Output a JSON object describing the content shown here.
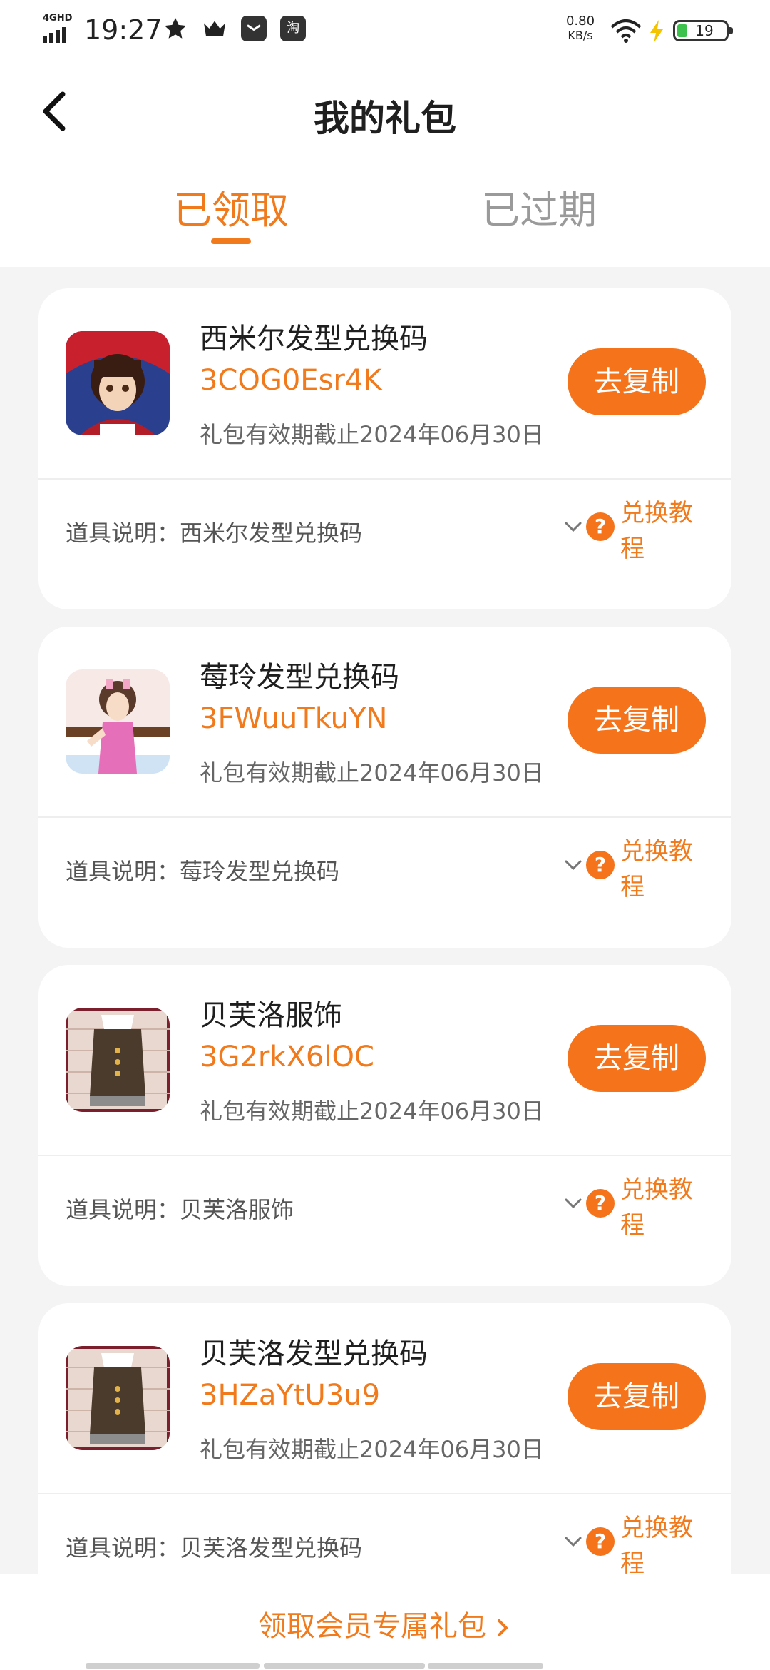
{
  "status_bar": {
    "network": "4GHD",
    "time": "19:27",
    "app_icon_label": "淘",
    "speed_value": "0.80",
    "speed_unit": "KB/s",
    "battery": "19"
  },
  "header": {
    "title": "我的礼包"
  },
  "tabs": [
    {
      "label": "已领取",
      "active": true
    },
    {
      "label": "已过期",
      "active": false
    }
  ],
  "cards": [
    {
      "name": "西米尔发型兑换码",
      "code": "3COG0Esr4K",
      "expiry": "礼包有效期截止2024年06月30日",
      "copy_label": "去复制",
      "desc_label": "道具说明：",
      "desc_value": "西米尔发型兑换码",
      "tutorial_label": "兑换教程",
      "thumb_icon": "character-red-hood-avatar"
    },
    {
      "name": "莓玲发型兑换码",
      "code": "3FWuuTkuYN",
      "expiry": "礼包有效期截止2024年06月30日",
      "copy_label": "去复制",
      "desc_label": "道具说明：",
      "desc_value": "莓玲发型兑换码",
      "tutorial_label": "兑换教程",
      "thumb_icon": "character-pink-dress-avatar"
    },
    {
      "name": "贝芙洛服饰",
      "code": "3G2rkX6lOC",
      "expiry": "礼包有效期截止2024年06月30日",
      "copy_label": "去复制",
      "desc_label": "道具说明：",
      "desc_value": "贝芙洛服饰",
      "tutorial_label": "兑换教程",
      "thumb_icon": "brown-outfit-avatar"
    },
    {
      "name": "贝芙洛发型兑换码",
      "code": "3HZaYtU3u9",
      "expiry": "礼包有效期截止2024年06月30日",
      "copy_label": "去复制",
      "desc_label": "道具说明：",
      "desc_value": "贝芙洛发型兑换码",
      "tutorial_label": "兑换教程",
      "thumb_icon": "brown-outfit-avatar"
    }
  ],
  "footer": {
    "member_link": "领取会员专属礼包"
  },
  "colors": {
    "accent": "#f07a1c",
    "button": "#f5731a",
    "background": "#f4f4f4"
  }
}
